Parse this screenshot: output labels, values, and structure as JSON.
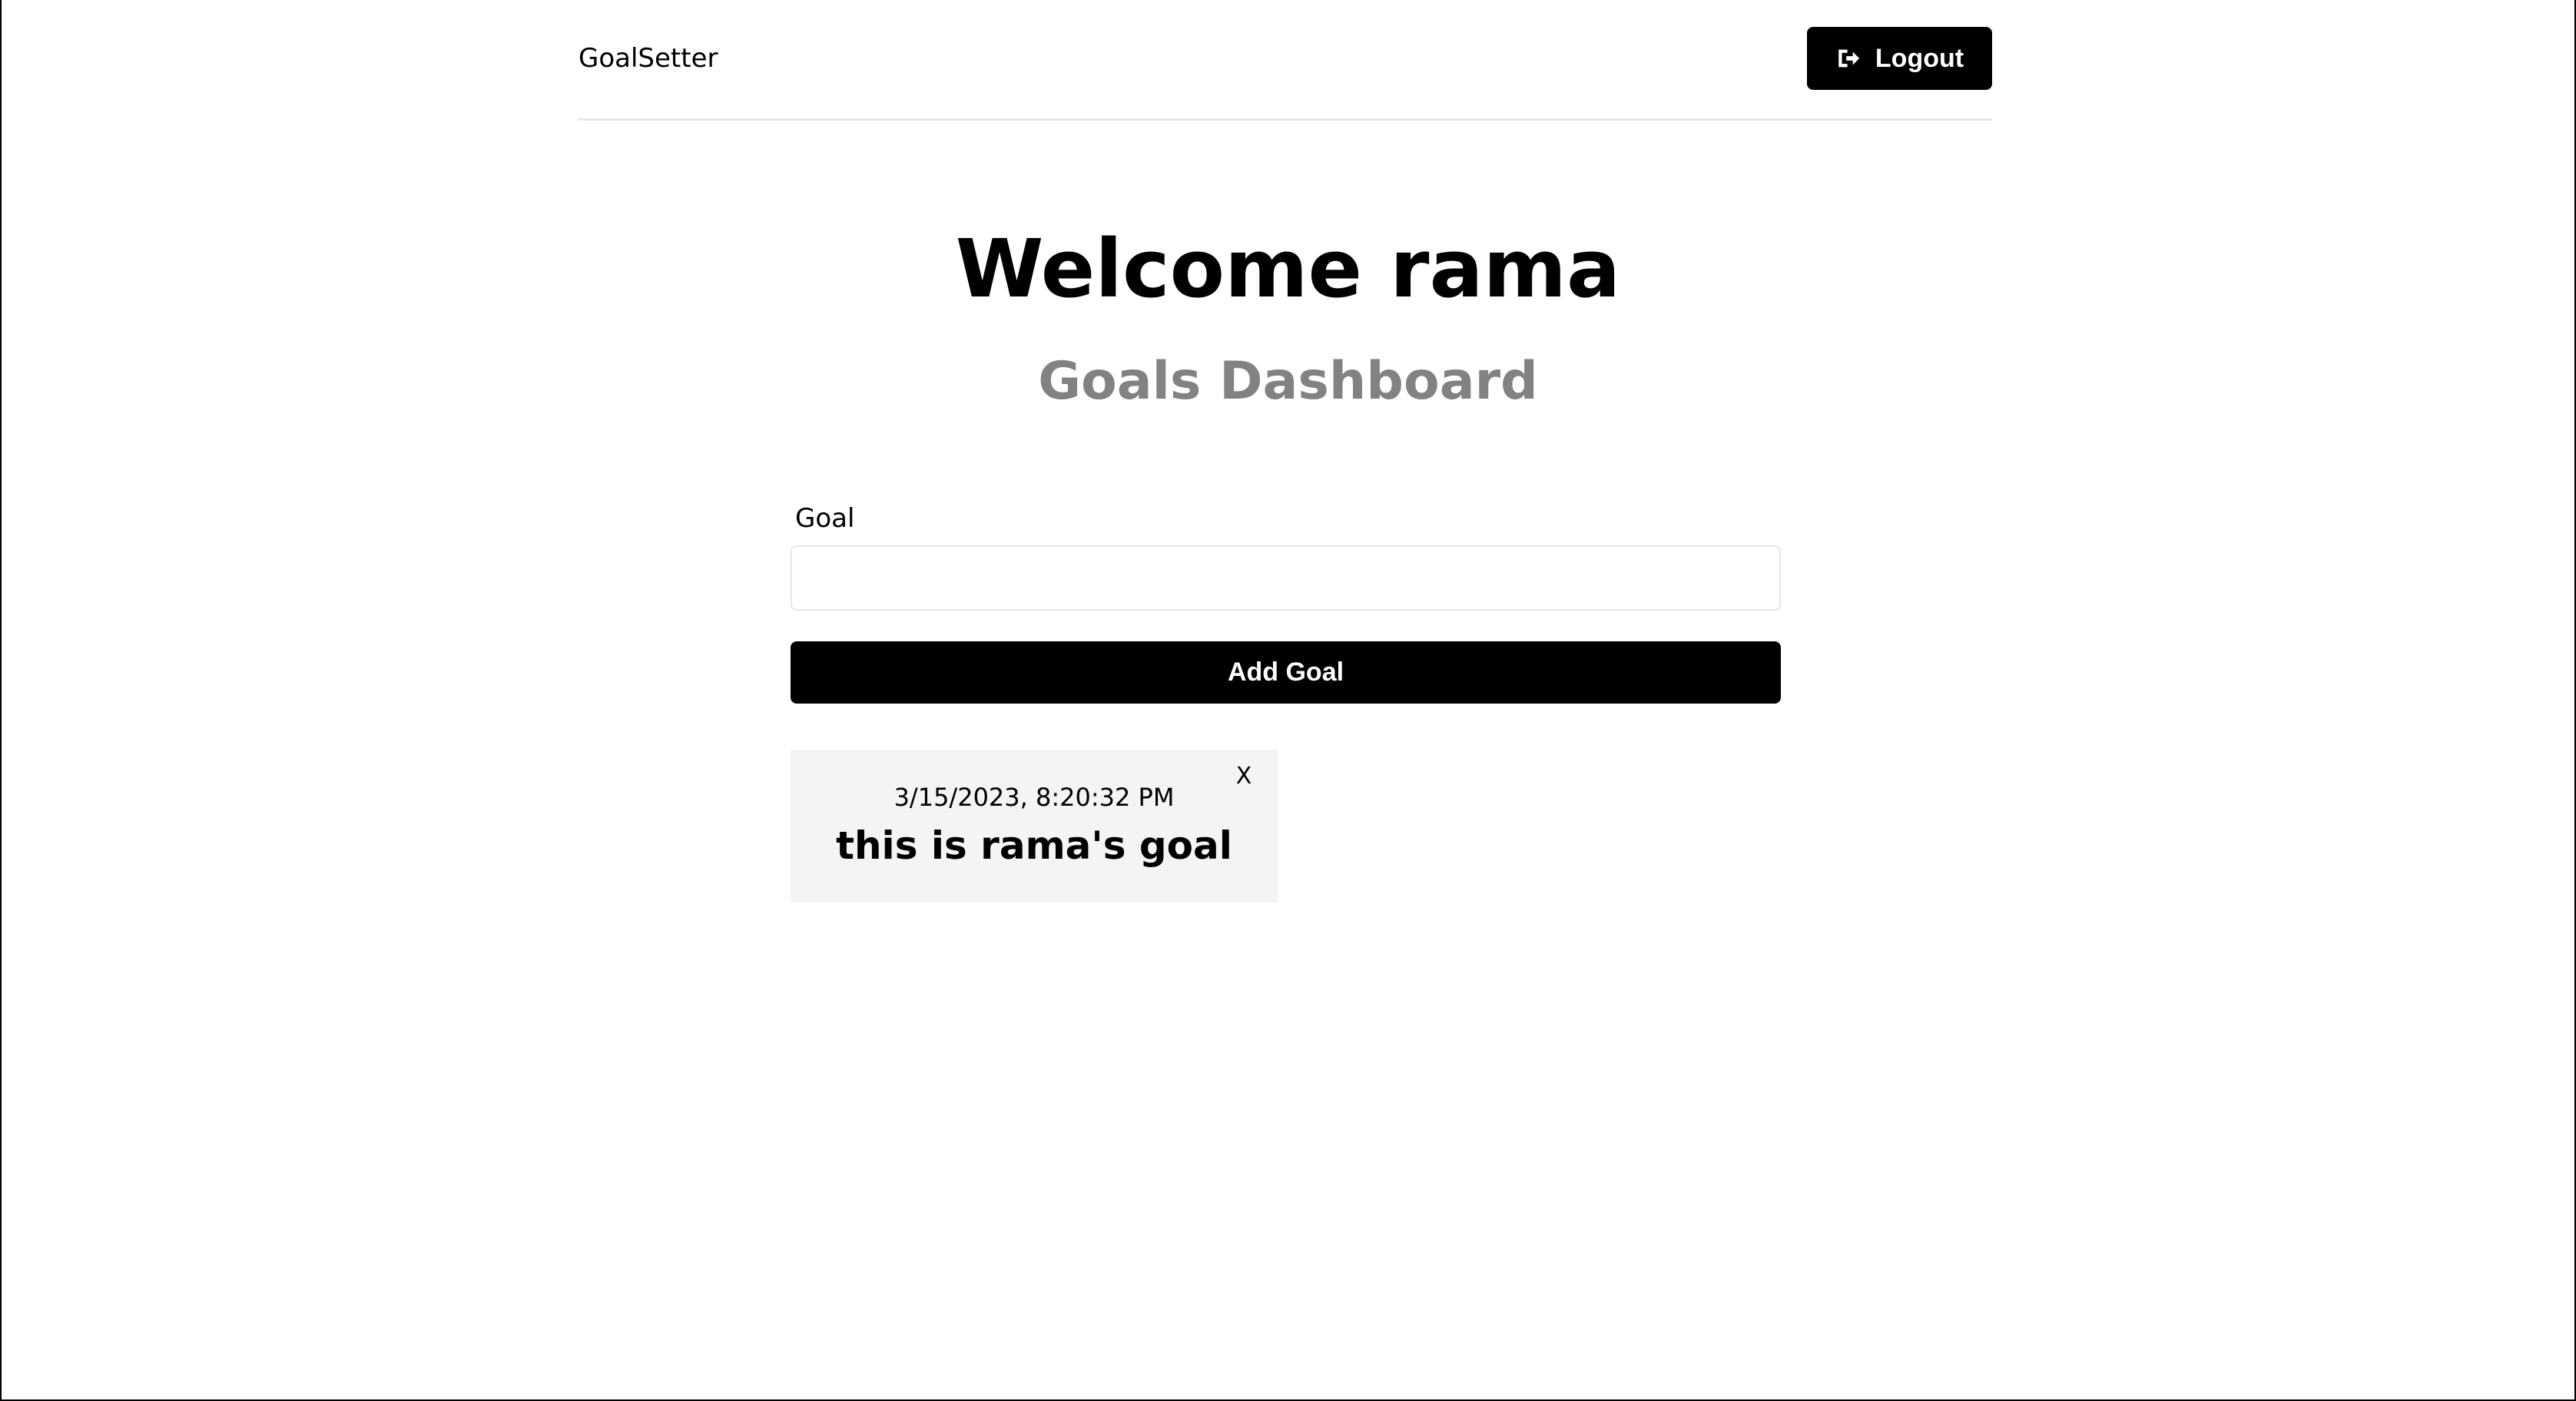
{
  "header": {
    "brand": "GoalSetter",
    "logout_label": "Logout",
    "logout_icon": "sign-out-icon"
  },
  "main": {
    "heading": "Welcome rama",
    "subheading": "Goals Dashboard"
  },
  "form": {
    "goal_label": "Goal",
    "goal_value": "",
    "goal_placeholder": "",
    "add_label": "Add Goal"
  },
  "goals": [
    {
      "date": "3/15/2023, 8:20:32 PM",
      "text": "this is rama's goal",
      "delete_label": "X"
    }
  ],
  "colors": {
    "primary": "#000000",
    "subheading": "#828282",
    "card_bg": "#f4f4f4",
    "divider": "#e6e6e6"
  }
}
